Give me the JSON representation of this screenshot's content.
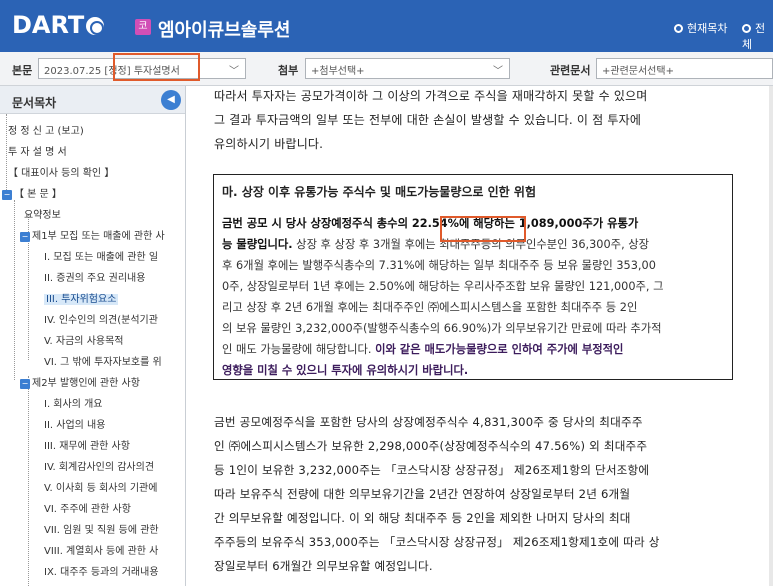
{
  "header": {
    "logo": "DART",
    "corp_badge": "코",
    "corp_name": "엠아이큐브솔루션",
    "link_current_toc": "현재목차",
    "link_full": "전체"
  },
  "toolbar": {
    "main_label": "본문",
    "main_value": "2023.07.25 [정정] 투자설명서",
    "attach_label": "첨부",
    "attach_value": "+첨부선택+",
    "related_label": "관련문서",
    "related_value": "+관련문서선택+"
  },
  "sidebar": {
    "title": "문서목차",
    "items": [
      "정 정 신 고 (보고)",
      "투 자 설 명 서",
      "【 대표이사 등의 확인 】",
      "【 본 문 】",
      "요약정보",
      "제1부 모집 또는 매출에 관한 사",
      "I. 모집 또는 매출에 관한 일",
      "II. 증권의 주요 권리내용",
      "III. 투자위험요소",
      "IV. 인수인의 의견(분석기관",
      "V. 자금의 사용목적",
      "VI. 그 밖에 투자자보호를 위",
      "제2부 발행인에 관한 사항",
      "I. 회사의 개요",
      "II. 사업의 내용",
      "III. 재무에 관한 사항",
      "IV. 회계감사인의 감사의견",
      "V. 이사회 등 회사의 기관에",
      "VI. 주주에 관한 사항",
      "VII. 임원 및 직원 등에 관한",
      "VIII. 계열회사 등에 관한 사",
      "IX. 대주주 등과의 거래내용"
    ]
  },
  "content": {
    "intro_line1": "따라서 투자자는 공모가격이하 그 이상의 가격으로 주식을 재매각하지 못할 수 있으며",
    "intro_line2": "그 결과 투자금액의 일부 또는 전부에 대한 손실이 발생할 수 있습니다. 이 점 투자에",
    "intro_line3": "유의하시기 바랍니다.",
    "risk_title": "마. 상장 이후 유통가능 주식수 및 매도가능물량으로 인한 위험",
    "risk_bold1": "금번 공모 시 당사 상장예정주식 총수의 22.54%에 해당하는 1,089,000주가 유통가",
    "risk_bold2": "능 물량입니다.",
    "risk_text1": " 상장 후 상장 후 3개월 후에는 최대주주등의 의무인수분인 36,300주, 상장",
    "risk_text2": "후 6개월 후에는 발행주식총수의 7.31%에 해당하는 일부 최대주주 등 보유 물량인 353,00",
    "risk_text3": "0주, 상장일로부터 1년 후에는 2.50%에 해당하는 우리사주조합 보유 물량인 121,000주, 그",
    "risk_text4": "리고 상장 후 2년 6개월 후에는 최대주주인 ㈜에스피시스템스을 포함한 최대주주 등 2인",
    "risk_text5": "의 보유 물량인 3,232,000주(발행주식총수의 66.90%)가 의무보유기간 만료에 따라 추가적",
    "risk_text6": "인 매도 가능물량에 해당합니다. ",
    "risk_warn1": "이와 같은 매도가능물량으로 인하여 주가에 부정적인",
    "risk_warn2": "영향을 미칠 수 있으니 투자에 유의하시기 바랍니다.",
    "body1": "금번 공모예정주식을 포함한 당사의 상장예정주식수 4,831,300주 중 당사의 최대주주",
    "body2": "인 ㈜에스피시스템스가 보유한 2,298,000주(상장예정주식수의 47.56%) 외 최대주주",
    "body3": "등 1인이 보유한 3,232,000주는 「코스닥시장 상장규정」 제26조제1항의 단서조항에",
    "body4": "따라 보유주식 전량에 대한 의무보유기간을 2년간 연장하여 상장일로부터 2년 6개월",
    "body5": "간 의무보유할 예정입니다. 이 외 해당 최대주주 등 2인을 제외한 나머지 당사의 최대",
    "body6": "주주등의 보유주식 353,000주는 「코스닥시장 상장규정」 제26조제1항제1호에 따라 상",
    "body7": "장일로부터 6개월간 의무보유할 예정입니다."
  },
  "colors": {
    "header_bg": "#2b63b5",
    "highlight": "#e05a2b",
    "accent": "#3c7fd2"
  }
}
